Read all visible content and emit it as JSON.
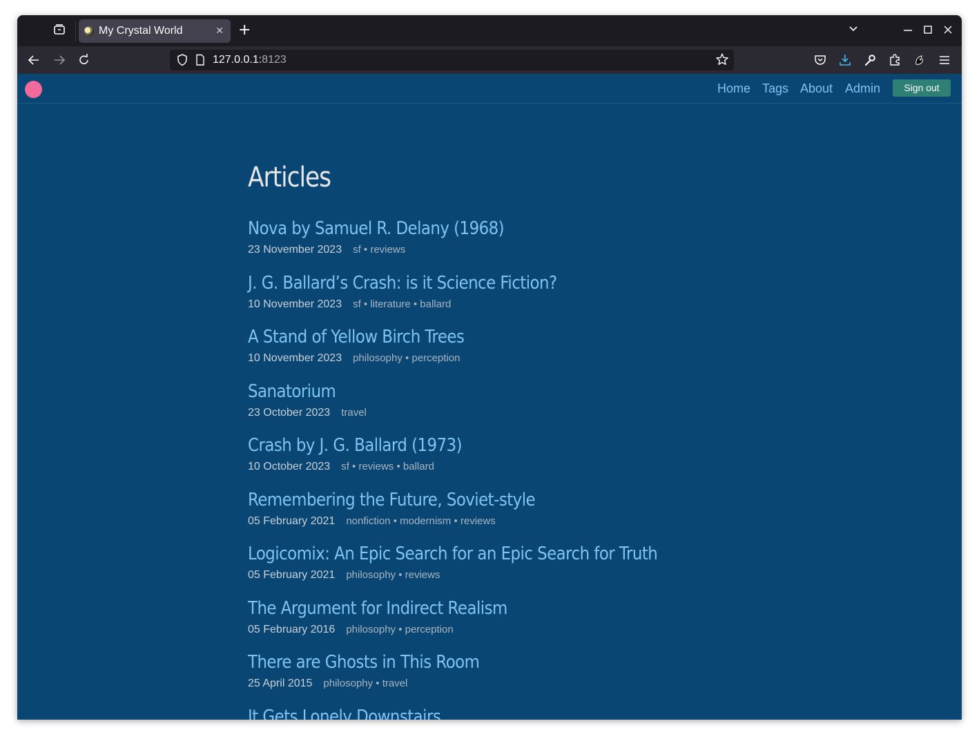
{
  "browser": {
    "tab_title": "My Crystal World",
    "url_host": "127.0.0.1:",
    "url_port": "8123"
  },
  "site": {
    "nav": [
      "Home",
      "Tags",
      "About",
      "Admin"
    ],
    "signout_label": "Sign out"
  },
  "page": {
    "title": "Articles",
    "articles": [
      {
        "title": "Nova by Samuel R. Delany (1968)",
        "date": "23 November 2023",
        "tags": "sf • reviews"
      },
      {
        "title": "J. G. Ballard’s Crash: is it Science Fiction?",
        "date": "10 November 2023",
        "tags": "sf • literature • ballard"
      },
      {
        "title": "A Stand of Yellow Birch Trees",
        "date": "10 November 2023",
        "tags": "philosophy • perception"
      },
      {
        "title": "Sanatorium",
        "date": "23 October 2023",
        "tags": "travel"
      },
      {
        "title": "Crash by J. G. Ballard (1973)",
        "date": "10 October 2023",
        "tags": "sf • reviews • ballard"
      },
      {
        "title": "Remembering the Future, Soviet-style",
        "date": "05 February 2021",
        "tags": "nonfiction • modernism • reviews"
      },
      {
        "title": "Logicomix: An Epic Search for an Epic Search for Truth",
        "date": "05 February 2021",
        "tags": "philosophy • reviews"
      },
      {
        "title": "The Argument for Indirect Realism",
        "date": "05 February 2016",
        "tags": "philosophy • perception"
      },
      {
        "title": "There are Ghosts in This Room",
        "date": "25 April 2015",
        "tags": "philosophy • travel"
      },
      {
        "title": "It Gets Lonely Downstairs",
        "date": "",
        "tags": ""
      }
    ]
  }
}
